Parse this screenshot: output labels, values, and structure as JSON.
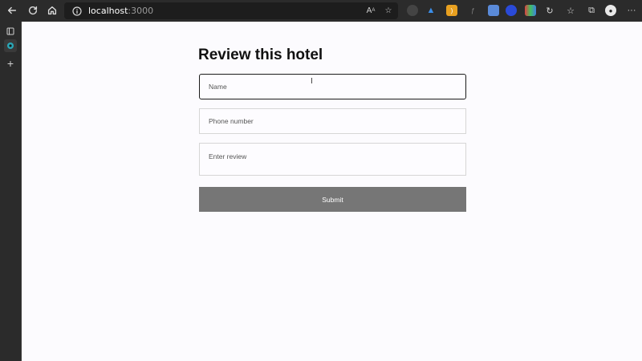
{
  "browser": {
    "address": "localhost",
    "port": ":3000",
    "colors": {
      "chrome": "#2b2b2b",
      "address_bg": "#1d1d1d"
    },
    "icons": [
      "back-arrow-icon",
      "refresh-icon",
      "home-icon",
      "info-icon",
      "read-aloud-icon",
      "favorite-add-icon",
      "collections-icon",
      "favorites-icon",
      "profile-icon",
      "more-icon"
    ]
  },
  "form": {
    "title": "Review this hotel",
    "name_placeholder": "Name",
    "phone_placeholder": "Phone number",
    "review_placeholder": "Enter review",
    "submit_label": "Submit",
    "colors": {
      "submit_bg": "#767676",
      "active_border": "#1b1b1b"
    }
  }
}
